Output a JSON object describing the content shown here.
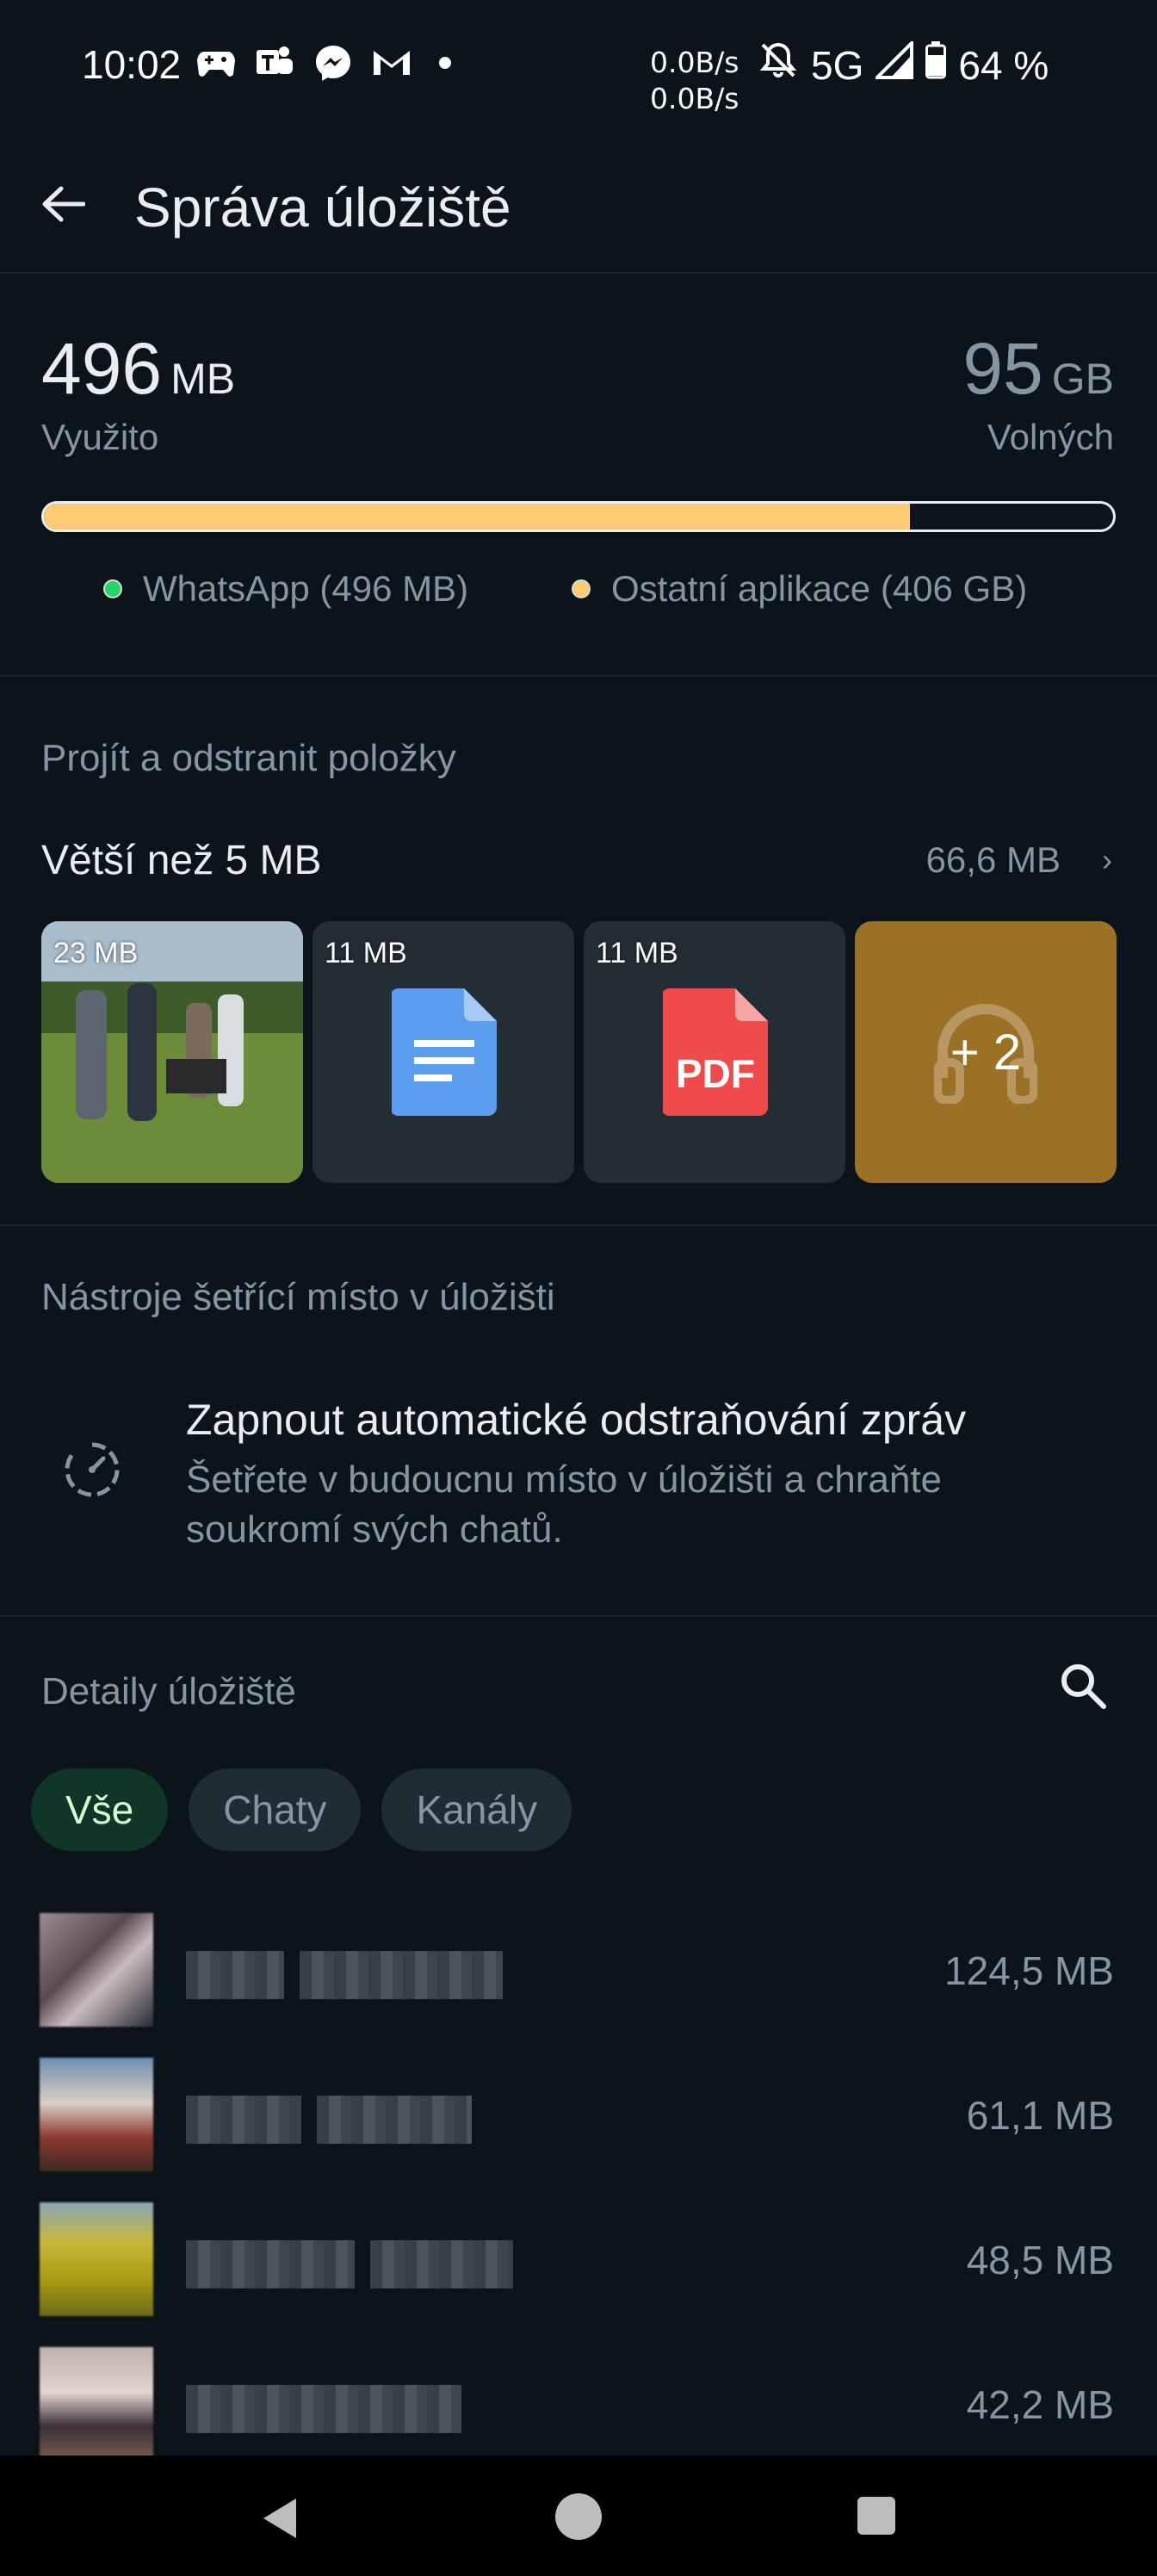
{
  "status_bar": {
    "time": "10:02",
    "speed_up": "0.0B/s",
    "speed_down": "0.0B/s",
    "network": "5G",
    "battery": "64 %"
  },
  "header": {
    "title": "Správa úložiště"
  },
  "usage": {
    "used_value": "496",
    "used_unit": "MB",
    "used_label": "Využito",
    "free_value": "95",
    "free_unit": "GB",
    "free_label": "Volných",
    "fill_fraction": 0.81,
    "legend": [
      {
        "label": "WhatsApp (496 MB)",
        "color": "#25d366"
      },
      {
        "label": "Ostatní aplikace (406 GB)",
        "color": "#fccb74"
      }
    ]
  },
  "review": {
    "section_title": "Projít a odstranit položky",
    "bigger_label": "Větší než 5 MB",
    "bigger_size": "66,6 MB",
    "tiles": [
      {
        "size": "23 MB",
        "kind": "photo"
      },
      {
        "size": "11 MB",
        "kind": "document"
      },
      {
        "size": "11 MB",
        "kind": "pdf",
        "badge": "PDF"
      },
      {
        "more": "+ 2",
        "kind": "audio"
      }
    ]
  },
  "tools": {
    "section_title": "Nástroje šetřící místo v úložišti",
    "item_title": "Zapnout automatické odstraňování zpráv",
    "item_desc": "Šetřete v budoucnu místo v úložišti a chraňte soukromí svých chatů."
  },
  "details": {
    "section_title": "Detaily úložiště",
    "chips": [
      "Vše",
      "Chaty",
      "Kanály"
    ],
    "rows": [
      {
        "size": "124,5 MB"
      },
      {
        "size": "61,1 MB"
      },
      {
        "size": "48,5 MB"
      },
      {
        "size": "42,2 MB"
      }
    ]
  }
}
